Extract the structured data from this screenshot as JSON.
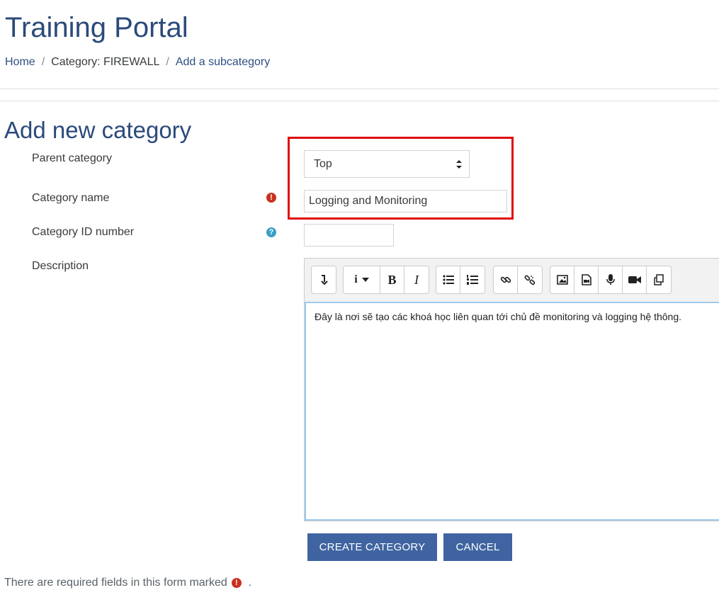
{
  "site": {
    "title": "Training Portal"
  },
  "breadcrumb": {
    "items": [
      "Home",
      "Category: FIREWALL",
      "Add a subcategory"
    ],
    "separator": "/"
  },
  "page": {
    "heading": "Add new category"
  },
  "form": {
    "parent_category": {
      "label": "Parent category",
      "value": "Top"
    },
    "category_name": {
      "label": "Category name",
      "value": "Logging and Monitoring",
      "required_icon": "!"
    },
    "category_id": {
      "label": "Category ID number",
      "value": "",
      "help_icon": "?"
    },
    "description": {
      "label": "Description",
      "value": "Đây là nơi sẽ tạo các khoá học liên quan tới chủ đề monitoring và logging hệ thông."
    },
    "toolbar_icons": [
      "collapse-icon",
      "info-style-icon",
      "bold-icon",
      "italic-icon",
      "unordered-list-icon",
      "ordered-list-icon",
      "link-icon",
      "unlink-icon",
      "image-icon",
      "media-icon",
      "record-audio-icon",
      "record-video-icon",
      "manage-files-icon"
    ],
    "buttons": {
      "create": "CREATE CATEGORY",
      "cancel": "CANCEL"
    }
  },
  "footer": {
    "required_note": "There are required fields in this form marked",
    "required_icon": "!",
    "period": "."
  },
  "colors": {
    "title": "#2b4a7a",
    "primary_button": "#3f64a1",
    "required": "#ca3120",
    "help": "#3a9fc8",
    "highlight": "#e00a0a"
  }
}
